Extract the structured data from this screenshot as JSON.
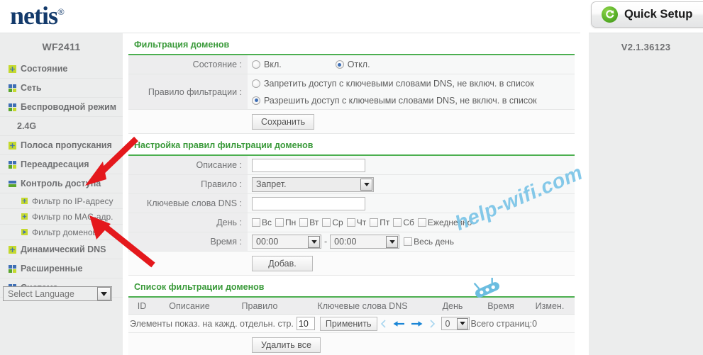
{
  "brand": {
    "name": "netis",
    "registered": "®"
  },
  "header": {
    "quick_setup_label": "Quick Setup",
    "quick_setup_icon": "refresh-circle-icon"
  },
  "sidebar": {
    "model": "WF2411",
    "items": [
      {
        "label": "Состояние",
        "icon": "plus-square-icon",
        "level": 0
      },
      {
        "label": "Сеть",
        "icon": "grid-squares-icon",
        "level": 0
      },
      {
        "label": "Беспроводной режим",
        "icon": "grid-squares-icon",
        "level": 0
      },
      {
        "label": "2.4G",
        "icon": "none",
        "level": 1
      },
      {
        "label": "Полоса пропускания",
        "icon": "plus-square-icon",
        "level": 0
      },
      {
        "label": "Переадресация",
        "icon": "grid-squares-icon",
        "level": 0
      },
      {
        "label": "Контроль доступа",
        "icon": "bars-expanded-icon",
        "level": 0
      },
      {
        "label": "Фильтр по IP-адресу",
        "icon": "plus-square-icon",
        "level": 2
      },
      {
        "label": "Фильтр по MAC-адр.",
        "icon": "plus-square-icon",
        "level": 2
      },
      {
        "label": "Фильтр доменов",
        "icon": "play-square-icon",
        "level": 2
      },
      {
        "label": "Динамический DNS",
        "icon": "plus-square-icon",
        "level": 0
      },
      {
        "label": "Расширенные",
        "icon": "grid-squares-icon",
        "level": 0
      },
      {
        "label": "Система",
        "icon": "grid-squares-icon",
        "level": 0
      }
    ],
    "language_select": {
      "value": "Select Language",
      "icon": "chevron-down-icon"
    }
  },
  "right_panel": {
    "version": "V2.1.36123"
  },
  "main": {
    "section1": {
      "title": "Фильтрация доменов",
      "state_label": "Состояние :",
      "state_on": "Вкл.",
      "state_off": "Откл.",
      "state_selected": "off",
      "rule_label": "Правило фильтрации :",
      "rule_deny": "Запретить доступ с ключевыми словами DNS, не включ. в список",
      "rule_allow": "Разрешить доступ с ключевыми словами DNS, не включ. в список",
      "rule_selected": "allow",
      "save_button": "Сохранить"
    },
    "section2": {
      "title": "Настройка правил фильтрации доменов",
      "desc_label": "Описание :",
      "desc_value": "",
      "rule_label": "Правило :",
      "rule_value": "Запрет.",
      "dns_label": "Ключевые слова DNS :",
      "dns_value": "",
      "day_label": "День :",
      "days": [
        "Вс",
        "Пн",
        "Вт",
        "Ср",
        "Чт",
        "Пт",
        "Сб",
        "Ежедневно"
      ],
      "time_label": "Время :",
      "time_from": "00:00",
      "time_to": "00:00",
      "time_sep": "-",
      "all_day_label": "Весь день",
      "add_button": "Добав."
    },
    "section3": {
      "title": "Список фильтрации доменов",
      "columns": [
        "ID",
        "Описание",
        "Правило",
        "Ключевые слова DNS",
        "День",
        "Время",
        "Измен."
      ],
      "rows": [],
      "per_page_label": "Элементы показ. на кажд. отдельн. стр.",
      "per_page_value": "10",
      "apply_button": "Применить",
      "page_select_value": "0",
      "total_pages_label": "Всего страниц:0",
      "delete_all_button": "Удалить все"
    }
  },
  "watermark": {
    "text": "help-wifi.com",
    "color": "#7ec6e8"
  },
  "annotations": {
    "arrow_color": "#e4181c",
    "arrow_count": 2
  }
}
